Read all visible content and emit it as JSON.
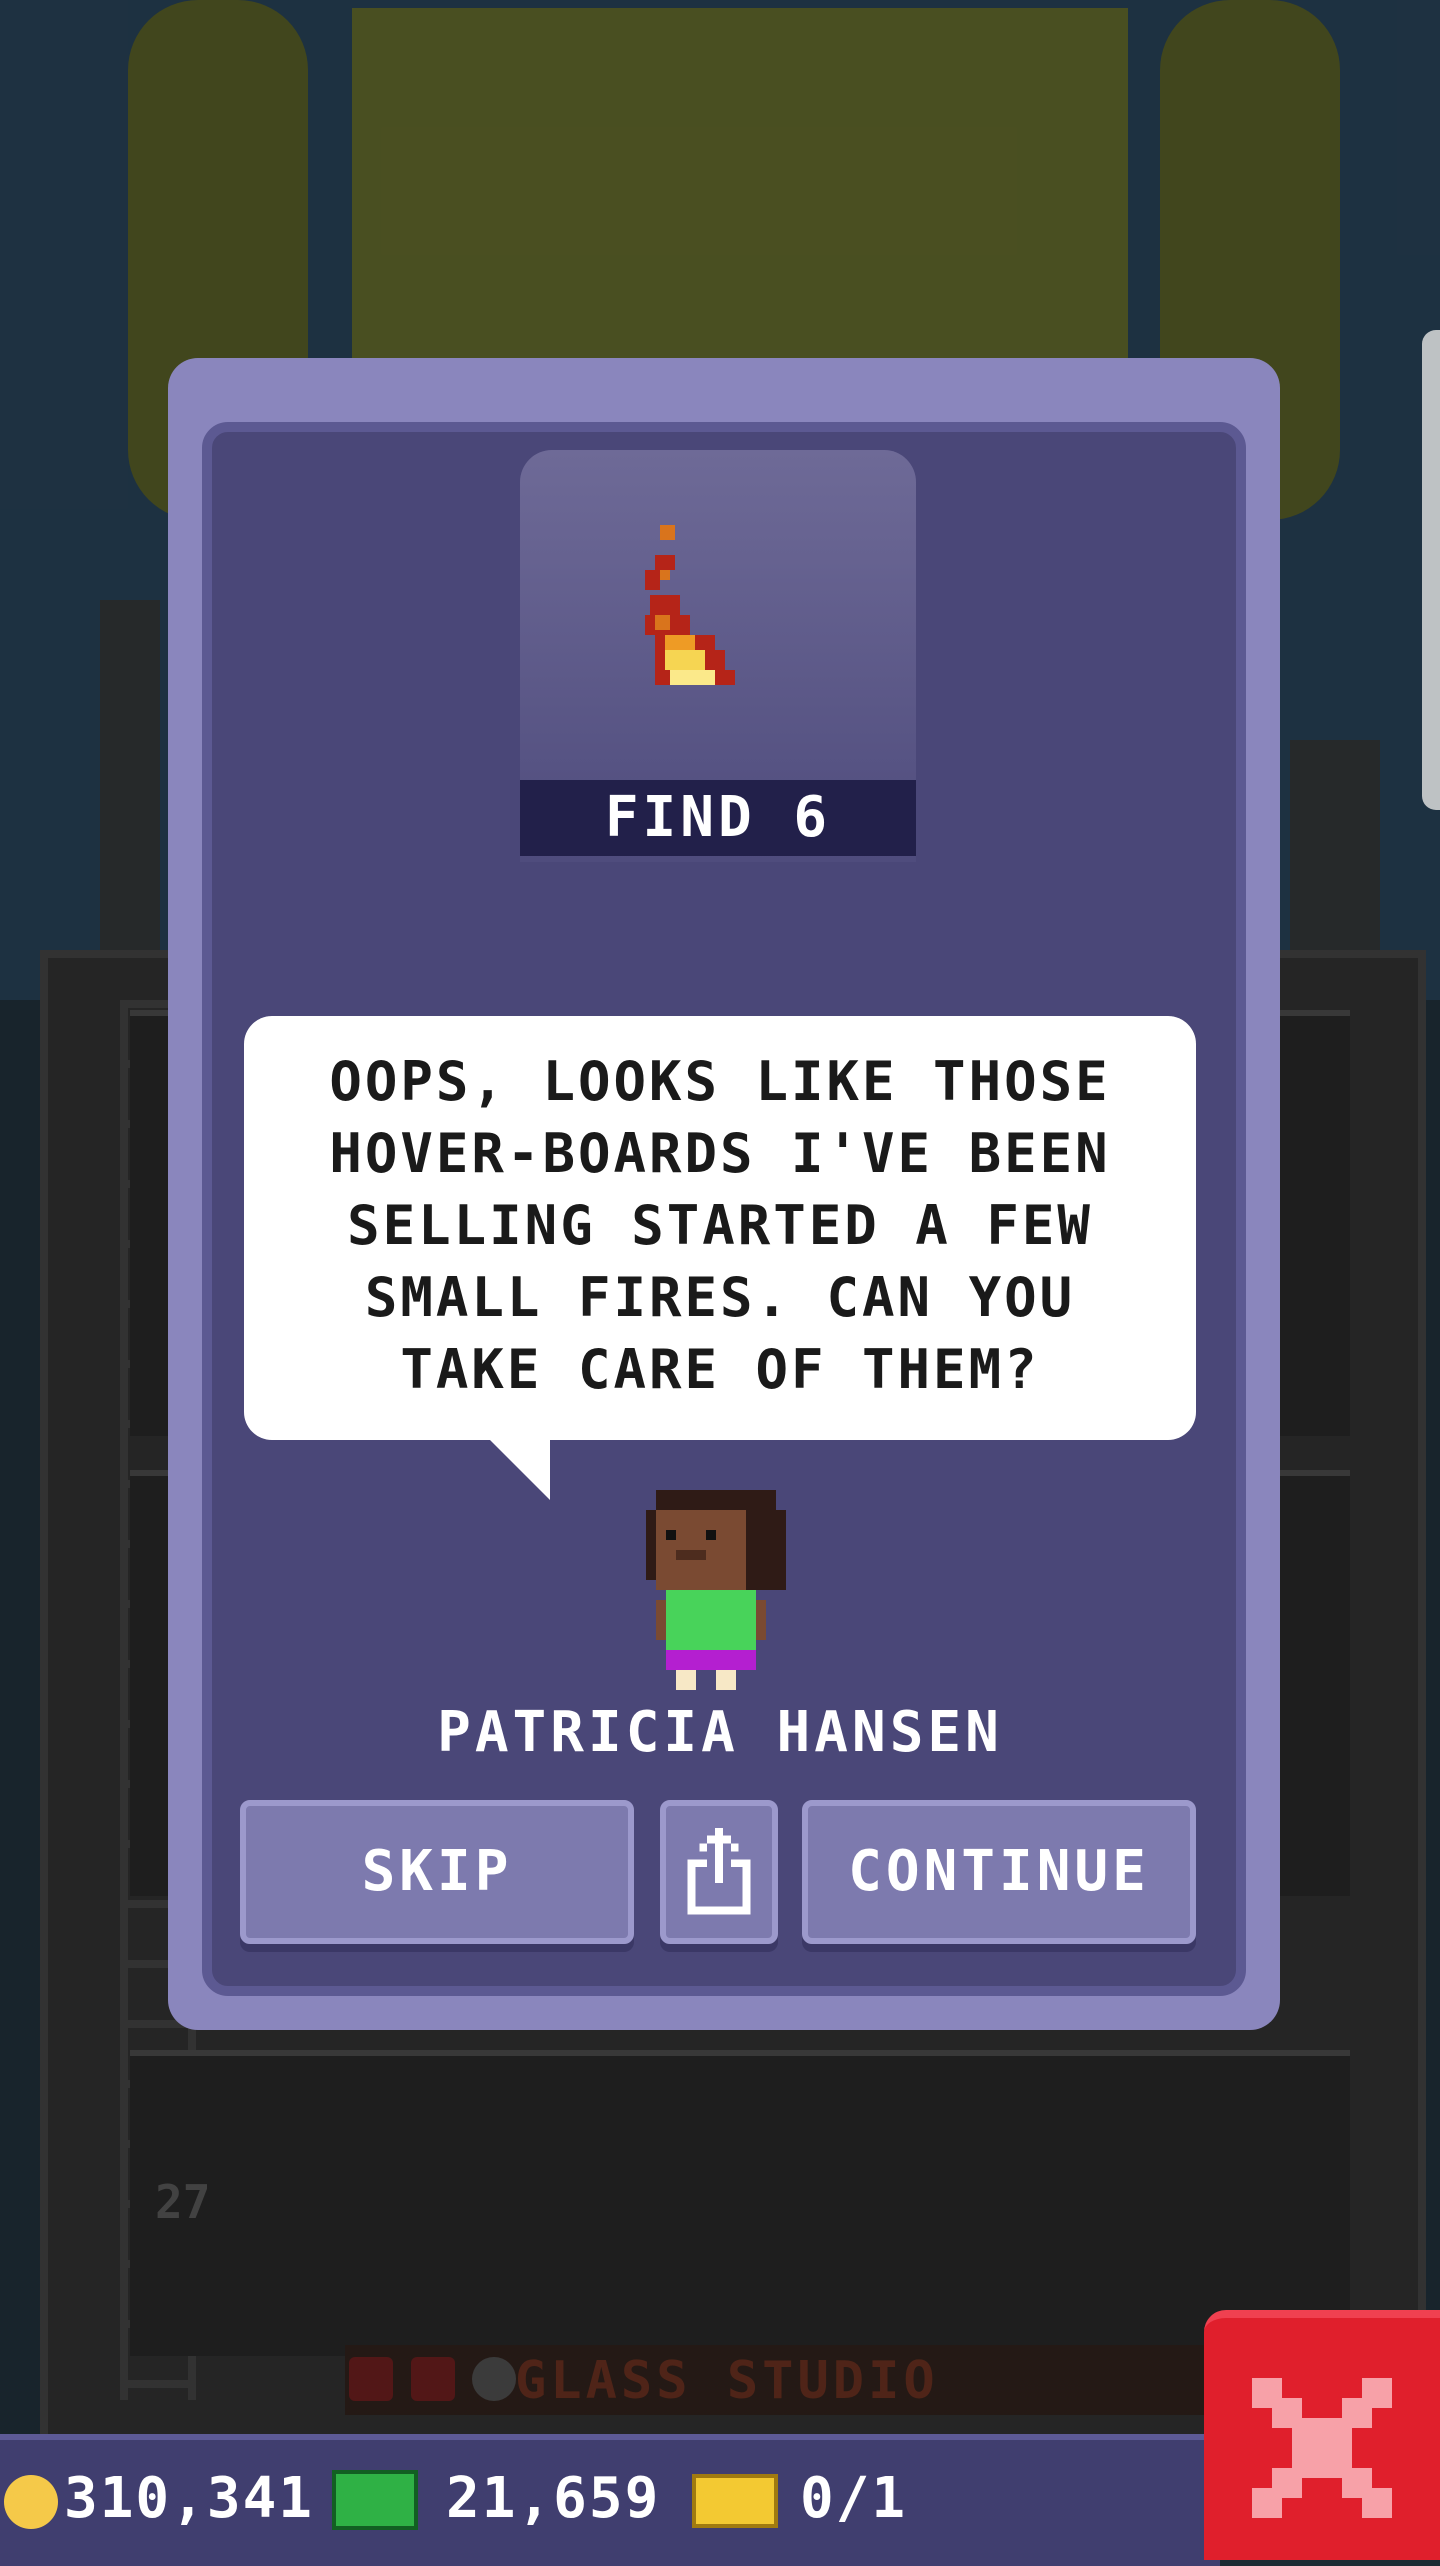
{
  "mission": {
    "reward_caption": "FIND 6",
    "reward_icon": "fire-icon",
    "speech": "OOPS, LOOKS LIKE THOSE HOVER-BOARDS I'VE BEEN SELLING STARTED A FEW SMALL FIRES. CAN YOU TAKE CARE OF THEM?",
    "character_name": "PATRICIA HANSEN",
    "skip_label": "SKIP",
    "share_icon": "share-icon",
    "continue_label": "CONTINUE"
  },
  "background": {
    "floor_number": "27",
    "studio_name": "GLASS STUDIO"
  },
  "status_bar": {
    "coins": "310,341",
    "bux": "21,659",
    "tickets": "0/1"
  },
  "colors": {
    "dialog_outer": "#8a86bd",
    "dialog_inner": "#4a4778",
    "button": "#7d7aae",
    "close_button": "#e01f2c",
    "coin": "#f5c949",
    "bux": "#2fb145",
    "ticket": "#f3c932"
  }
}
